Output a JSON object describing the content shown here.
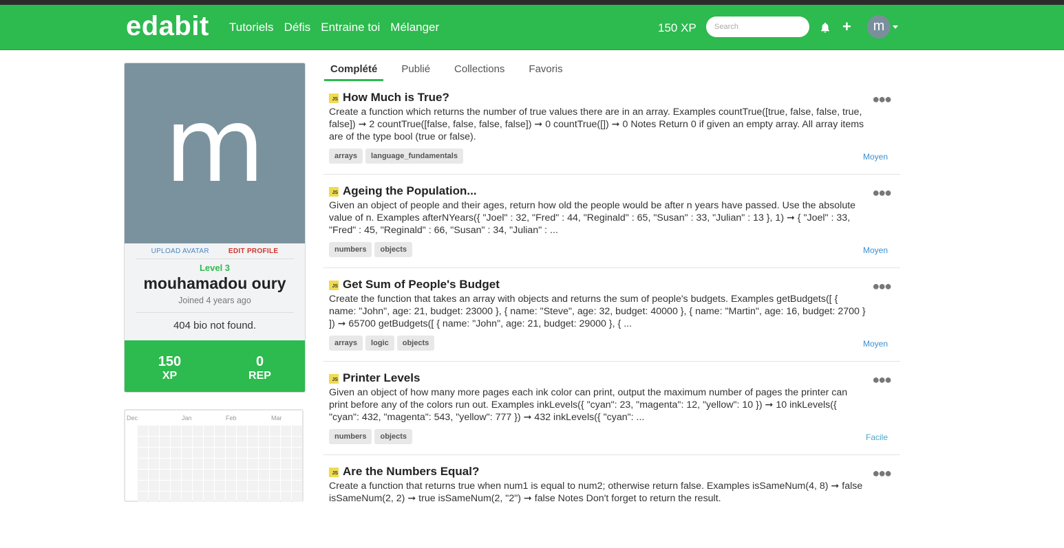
{
  "navbar": {
    "logo": "edabit",
    "links": [
      "Tutoriels",
      "Défis",
      "Entraine toi",
      "Mélanger"
    ],
    "xp": "150 XP",
    "search_placeholder": "Search",
    "avatar_letter": "m",
    "brand_color": "#2dba4e"
  },
  "profile": {
    "avatar_letter": "m",
    "upload_avatar": "UPLOAD AVATAR",
    "edit_profile": "EDIT PROFILE",
    "level": "Level 3",
    "name": "mouhamadou oury",
    "joined": "Joined 4 years ago",
    "bio": "404 bio not found.",
    "xp_value": "150",
    "xp_label": "XP",
    "rep_value": "0",
    "rep_label": "REP"
  },
  "heatmap": {
    "months": [
      "Dec",
      "Jan",
      "Feb",
      "Mar"
    ]
  },
  "tabs": [
    "Complété",
    "Publié",
    "Collections",
    "Favoris"
  ],
  "challenges": [
    {
      "lang": "JS",
      "title": "How Much is True?",
      "desc": "Create a function which returns the number of true values there are in an array. Examples countTrue([true, false, false, true, false]) ➞ 2 countTrue([false, false, false, false]) ➞ 0 countTrue([]) ➞ 0 Notes Return 0 if given an empty array. All array items are of the type bool (true or false).",
      "tags": [
        "arrays",
        "language_fundamentals"
      ],
      "difficulty": "Moyen"
    },
    {
      "lang": "JS",
      "title": "Ageing the Population...",
      "desc": "Given an object of people and their ages, return how old the people would be after n years have passed. Use the absolute value of n. Examples afterNYears({ \"Joel\" : 32, \"Fred\" : 44, \"Reginald\" : 65, \"Susan\" : 33, \"Julian\" : 13 }, 1) ➞ { \"Joel\" : 33, \"Fred\" : 45, \"Reginald\" : 66, \"Susan\" : 34, \"Julian\" : ...",
      "tags": [
        "numbers",
        "objects"
      ],
      "difficulty": "Moyen"
    },
    {
      "lang": "JS",
      "title": "Get Sum of People's Budget",
      "desc": "Create the function that takes an array with objects and returns the sum of people's budgets. Examples getBudgets([ { name: \"John\", age: 21, budget: 23000 }, { name: \"Steve\", age: 32, budget: 40000 }, { name: \"Martin\", age: 16, budget: 2700 } ]) ➞ 65700 getBudgets([ { name: \"John\", age: 21, budget: 29000 }, { ...",
      "tags": [
        "arrays",
        "logic",
        "objects"
      ],
      "difficulty": "Moyen"
    },
    {
      "lang": "JS",
      "title": "Printer Levels",
      "desc": "Given an object of how many more pages each ink color can print, output the maximum number of pages the printer can print before any of the colors run out. Examples inkLevels({ \"cyan\": 23, \"magenta\": 12, \"yellow\": 10 }) ➞ 10 inkLevels({ \"cyan\": 432, \"magenta\": 543, \"yellow\": 777 }) ➞ 432 inkLevels({ \"cyan\": ...",
      "tags": [
        "numbers",
        "objects"
      ],
      "difficulty": "Facile"
    },
    {
      "lang": "JS",
      "title": "Are the Numbers Equal?",
      "desc": "Create a function that returns true when num1 is equal to num2; otherwise return false. Examples isSameNum(4, 8) ➞ false isSameNum(2, 2) ➞ true isSameNum(2, \"2\") ➞ false Notes Don't forget to return the result.",
      "tags": [],
      "difficulty": ""
    }
  ]
}
